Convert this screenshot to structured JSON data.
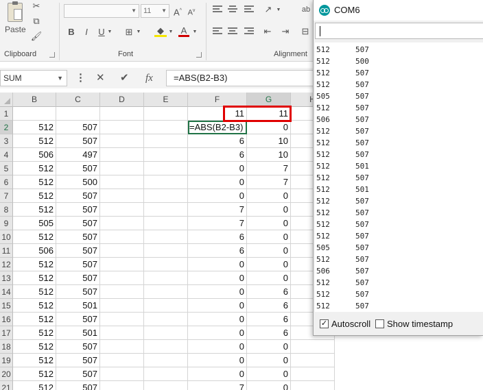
{
  "ribbon": {
    "clipboard_label": "Clipboard",
    "paste_label": "Paste",
    "font_label": "Font",
    "font_size": "11",
    "alignment_label": "Alignment",
    "bold": "B",
    "italic": "I",
    "underline": "U"
  },
  "formula_bar": {
    "name_box": "SUM",
    "formula": "=ABS(B2-B3)",
    "fx": "fx"
  },
  "sheet": {
    "columns": [
      "B",
      "C",
      "D",
      "E",
      "F",
      "G",
      "H"
    ],
    "active_column": "G",
    "rows": [
      {
        "n": "1",
        "B": "",
        "C": "",
        "F": "11",
        "G": "11"
      },
      {
        "n": "2",
        "B": "512",
        "C": "507",
        "F": "=ABS(B2-B3)",
        "G": "0"
      },
      {
        "n": "3",
        "B": "512",
        "C": "507",
        "F": "6",
        "G": "10"
      },
      {
        "n": "4",
        "B": "506",
        "C": "497",
        "F": "6",
        "G": "10"
      },
      {
        "n": "5",
        "B": "512",
        "C": "507",
        "F": "0",
        "G": "7"
      },
      {
        "n": "6",
        "B": "512",
        "C": "500",
        "F": "0",
        "G": "7"
      },
      {
        "n": "7",
        "B": "512",
        "C": "507",
        "F": "0",
        "G": "0"
      },
      {
        "n": "8",
        "B": "512",
        "C": "507",
        "F": "7",
        "G": "0"
      },
      {
        "n": "9",
        "B": "505",
        "C": "507",
        "F": "7",
        "G": "0"
      },
      {
        "n": "10",
        "B": "512",
        "C": "507",
        "F": "6",
        "G": "0"
      },
      {
        "n": "11",
        "B": "506",
        "C": "507",
        "F": "6",
        "G": "0"
      },
      {
        "n": "12",
        "B": "512",
        "C": "507",
        "F": "0",
        "G": "0"
      },
      {
        "n": "13",
        "B": "512",
        "C": "507",
        "F": "0",
        "G": "0"
      },
      {
        "n": "14",
        "B": "512",
        "C": "507",
        "F": "0",
        "G": "6"
      },
      {
        "n": "15",
        "B": "512",
        "C": "501",
        "F": "0",
        "G": "6"
      },
      {
        "n": "16",
        "B": "512",
        "C": "507",
        "F": "0",
        "G": "6"
      },
      {
        "n": "17",
        "B": "512",
        "C": "501",
        "F": "0",
        "G": "6"
      },
      {
        "n": "18",
        "B": "512",
        "C": "507",
        "F": "0",
        "G": "0"
      },
      {
        "n": "19",
        "B": "512",
        "C": "507",
        "F": "0",
        "G": "0"
      },
      {
        "n": "20",
        "B": "512",
        "C": "507",
        "F": "0",
        "G": "0"
      },
      {
        "n": "21",
        "B": "512",
        "C": "507",
        "F": "7",
        "G": "0"
      }
    ]
  },
  "serial_monitor": {
    "title": "COM6",
    "lines": [
      [
        "512",
        "507"
      ],
      [
        "512",
        "500"
      ],
      [
        "512",
        "507"
      ],
      [
        "512",
        "507"
      ],
      [
        "505",
        "507"
      ],
      [
        "512",
        "507"
      ],
      [
        "506",
        "507"
      ],
      [
        "512",
        "507"
      ],
      [
        "512",
        "507"
      ],
      [
        "512",
        "507"
      ],
      [
        "512",
        "501"
      ],
      [
        "512",
        "507"
      ],
      [
        "512",
        "501"
      ],
      [
        "512",
        "507"
      ],
      [
        "512",
        "507"
      ],
      [
        "512",
        "507"
      ],
      [
        "512",
        "507"
      ],
      [
        "505",
        "507"
      ],
      [
        "512",
        "507"
      ],
      [
        "506",
        "507"
      ],
      [
        "512",
        "507"
      ],
      [
        "512",
        "507"
      ],
      [
        "512",
        "507"
      ]
    ],
    "autoscroll_label": "Autoscroll",
    "autoscroll_checked": true,
    "timestamp_label": "Show timestamp",
    "timestamp_checked": false
  },
  "colors": {
    "excel_green": "#217346",
    "highlight_red": "#e00000",
    "arduino_teal": "#00979c"
  }
}
